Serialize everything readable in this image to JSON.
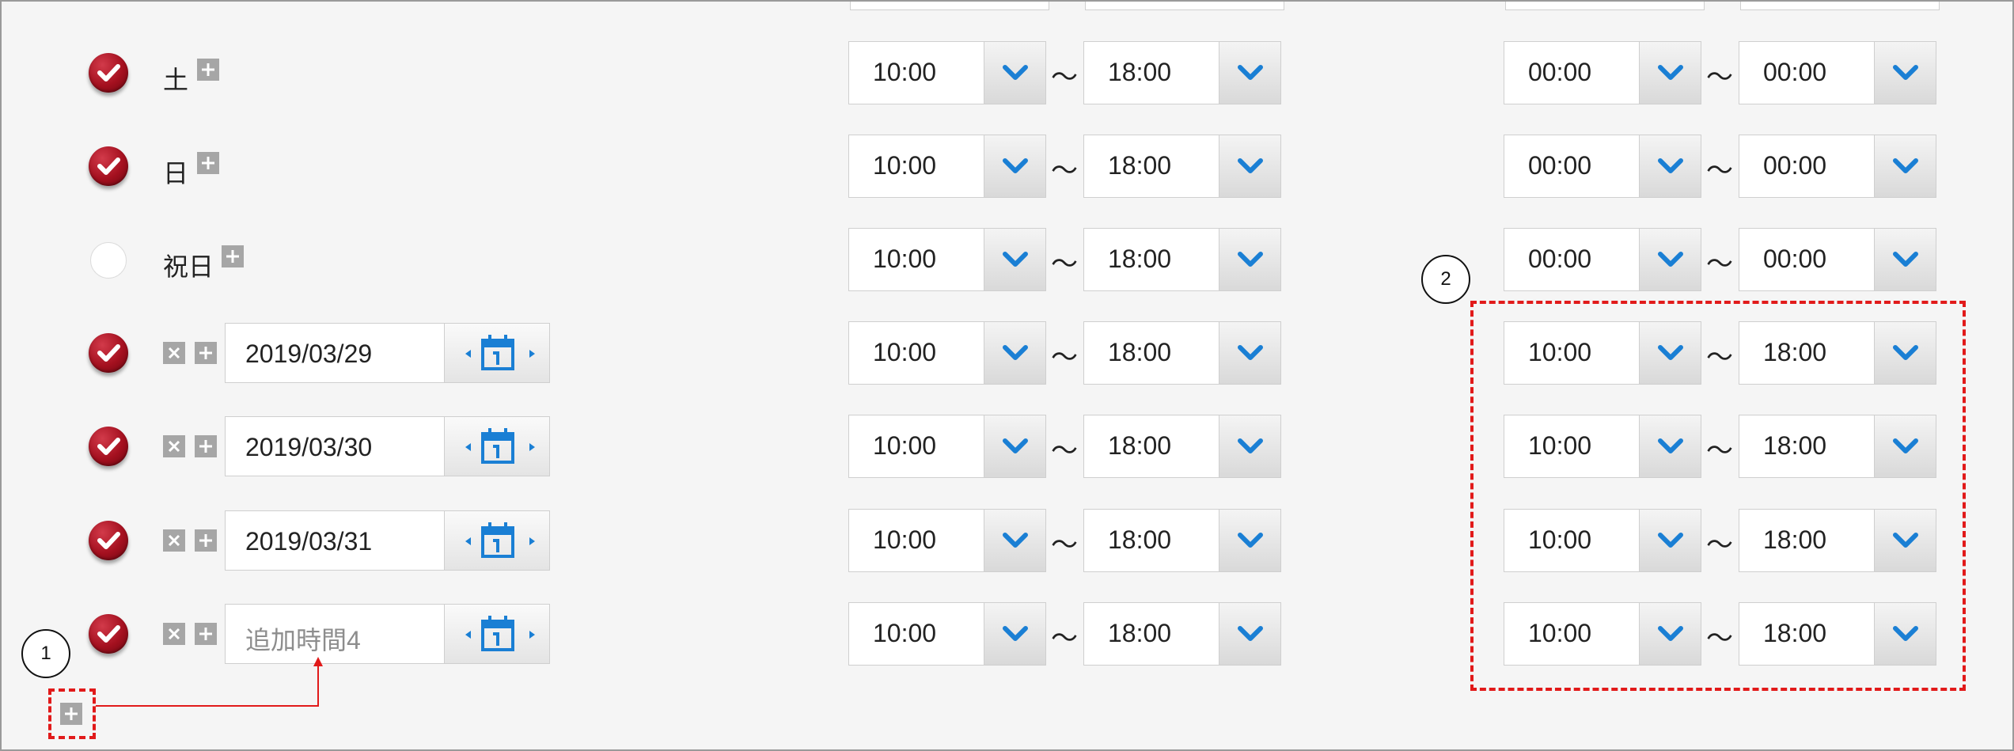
{
  "rows": [
    {
      "checked": true,
      "type": "day",
      "label": "土",
      "start": "10:00",
      "end": "18:00",
      "start2": "00:00",
      "end2": "00:00"
    },
    {
      "checked": true,
      "type": "day",
      "label": "日",
      "start": "10:00",
      "end": "18:00",
      "start2": "00:00",
      "end2": "00:00"
    },
    {
      "checked": false,
      "type": "day",
      "label": "祝日",
      "start": "10:00",
      "end": "18:00",
      "start2": "00:00",
      "end2": "00:00"
    },
    {
      "checked": true,
      "type": "date",
      "date": "2019/03/29",
      "start": "10:00",
      "end": "18:00",
      "start2": "10:00",
      "end2": "18:00"
    },
    {
      "checked": true,
      "type": "date",
      "date": "2019/03/30",
      "start": "10:00",
      "end": "18:00",
      "start2": "10:00",
      "end2": "18:00"
    },
    {
      "checked": true,
      "type": "date",
      "date": "2019/03/31",
      "start": "10:00",
      "end": "18:00",
      "start2": "10:00",
      "end2": "18:00"
    },
    {
      "checked": true,
      "type": "date",
      "date": "",
      "date_placeholder": "追加時間4",
      "start": "10:00",
      "end": "18:00",
      "start2": "10:00",
      "end2": "18:00"
    }
  ],
  "separator": "～",
  "annotations": {
    "one": "1",
    "two": "2"
  },
  "colors": {
    "accent_red": "#e11a1a",
    "check_red": "#a4101f",
    "arrow_blue": "#1a7fd4"
  },
  "icons": {
    "check": "check-icon",
    "plus": "plus-icon",
    "remove": "remove-icon",
    "calendar": "calendar-icon",
    "chevron": "chevron-down-icon"
  }
}
